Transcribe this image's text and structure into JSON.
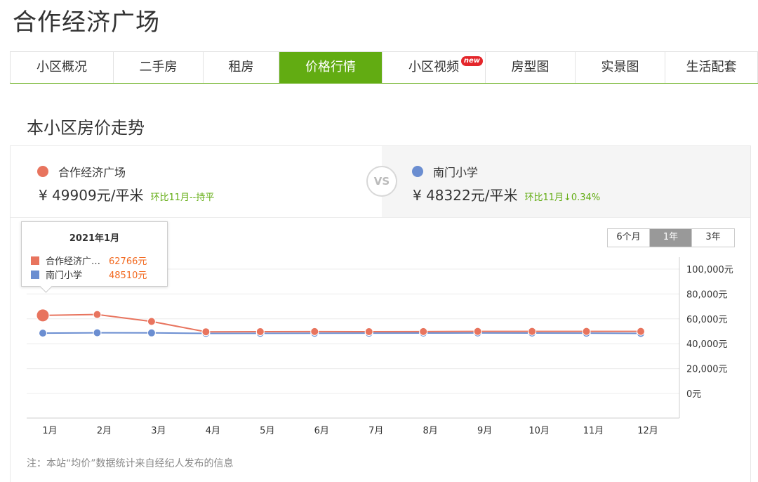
{
  "page_title": "合作经济广场",
  "tabs": [
    {
      "label": "小区概况",
      "active": false
    },
    {
      "label": "二手房",
      "active": false
    },
    {
      "label": "租房",
      "active": false
    },
    {
      "label": "价格行情",
      "active": true
    },
    {
      "label": "小区视频",
      "active": false,
      "badge": "new"
    },
    {
      "label": "房型图",
      "active": false
    },
    {
      "label": "实景图",
      "active": false
    },
    {
      "label": "生活配套",
      "active": false
    }
  ],
  "section_title": "本小区房价走势",
  "compare": {
    "left": {
      "name": "合作经济广场",
      "price": "¥ 49909元/平米",
      "change": "环比11月--持平",
      "color": "#e8745e"
    },
    "vs": "VS",
    "right": {
      "name": "南门小学",
      "price": "¥ 48322元/平米",
      "change": "环比11月↓0.34%",
      "color": "#6b8ed1"
    }
  },
  "range_buttons": [
    {
      "label": "6个月",
      "active": false
    },
    {
      "label": "1年",
      "active": true
    },
    {
      "label": "3年",
      "active": false
    }
  ],
  "tooltip": {
    "title": "2021年1月",
    "rows": [
      {
        "name": "合作经济广…",
        "value": "62766元",
        "color": "#e8745e"
      },
      {
        "name": "南门小学",
        "value": "48510元",
        "color": "#6b8ed1"
      }
    ]
  },
  "chart_data": {
    "type": "line",
    "categories": [
      "1月",
      "2月",
      "3月",
      "4月",
      "5月",
      "6月",
      "7月",
      "8月",
      "9月",
      "10月",
      "11月",
      "12月"
    ],
    "series": [
      {
        "name": "合作经济广场",
        "color": "#e8745e",
        "values": [
          62766,
          63500,
          57900,
          49600,
          49700,
          49800,
          49700,
          49800,
          49900,
          49909,
          49909,
          49909
        ]
      },
      {
        "name": "南门小学",
        "color": "#6b8ed1",
        "values": [
          48510,
          48800,
          48700,
          48300,
          48400,
          48450,
          48500,
          48600,
          48650,
          48600,
          48487,
          48322
        ]
      }
    ],
    "y_ticks": [
      0,
      20000,
      40000,
      60000,
      80000,
      100000
    ],
    "y_tick_labels": [
      "0元",
      "20,000元",
      "40,000元",
      "60,000元",
      "80,000元",
      "100,000元"
    ],
    "ylim": [
      0,
      100000
    ],
    "grid": true,
    "highlighted_index": 0
  },
  "note": "注：本站“均价”数据统计来自经纪人发布的信息"
}
